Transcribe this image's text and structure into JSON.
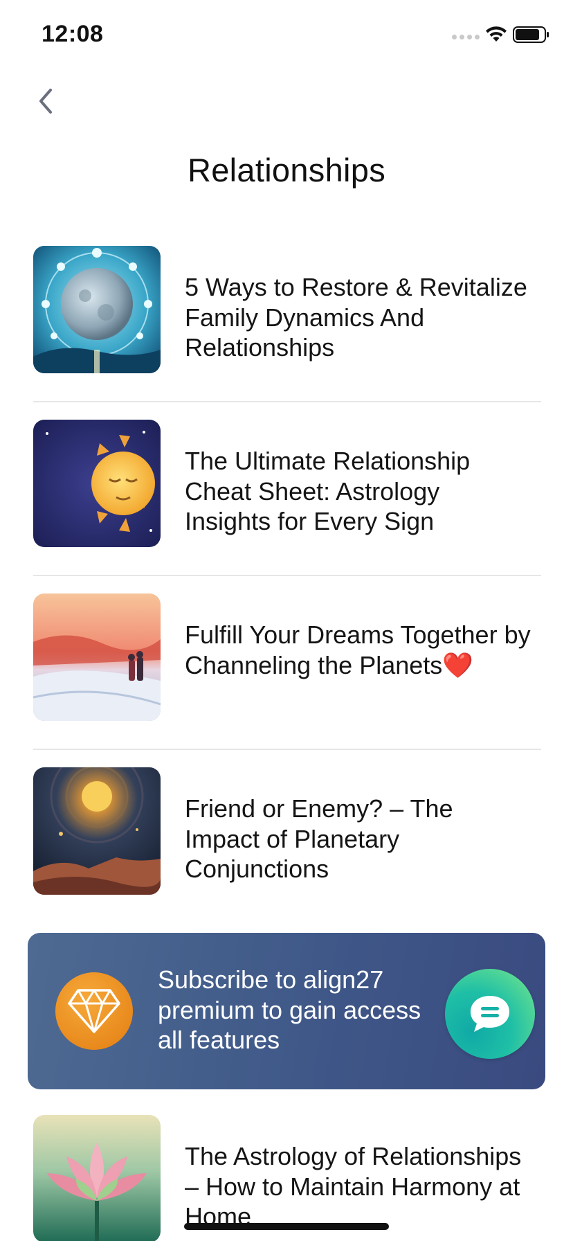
{
  "status_bar": {
    "time": "12:08",
    "wifi_icon": "wifi-icon",
    "battery_icon": "battery-icon"
  },
  "nav": {
    "back_icon": "chevron-left-icon",
    "title": "Relationships"
  },
  "articles": [
    {
      "title": "5 Ways to Restore & Revitalize Family Dynamics And Relationships",
      "thumbnail": "moon-circle-image"
    },
    {
      "title": "The Ultimate Relationship Cheat Sheet: Astrology Insights for Every Sign",
      "thumbnail": "sun-moon-image"
    },
    {
      "title": "Fulfill Your Dreams Together by Channeling the Planets❤️",
      "thumbnail": "couple-sunset-image"
    },
    {
      "title": "Friend or Enemy? – The Impact of Planetary Conjunctions",
      "thumbnail": "planet-desert-image"
    },
    {
      "title": "The Astrology of Relationships – How to Maintain Harmony at Home",
      "thumbnail": "lotus-image"
    }
  ],
  "promo": {
    "icon": "diamond-icon",
    "line1": "Subscribe to align27",
    "line2": "premium to gain access",
    "line3": "all features"
  },
  "chat": {
    "icon": "chat-bubble-icon"
  },
  "colors": {
    "banner": "#45608c",
    "badge": "#ea8c1f",
    "chat_start": "#10a9a6",
    "chat_end": "#7be98a"
  }
}
